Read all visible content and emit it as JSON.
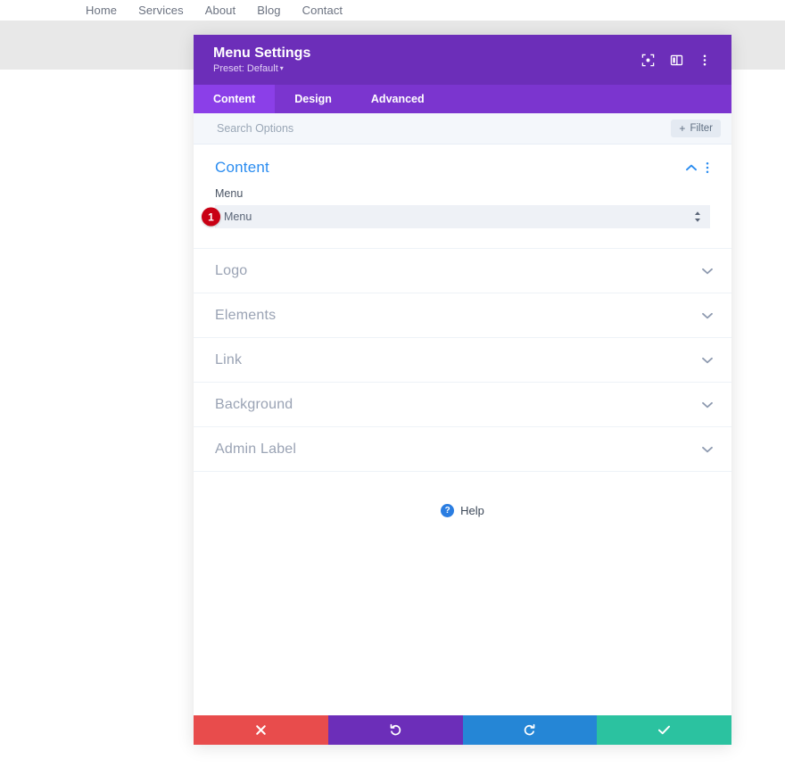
{
  "site": {
    "nav_items": [
      {
        "label": "Home"
      },
      {
        "label": "Services"
      },
      {
        "label": "About"
      },
      {
        "label": "Blog"
      },
      {
        "label": "Contact"
      }
    ]
  },
  "modal": {
    "title": "Menu Settings",
    "preset": "Preset: Default",
    "preset_caret": "▾",
    "header_icons": [
      {
        "name": "fullscreen-icon"
      },
      {
        "name": "layout-columns-icon"
      },
      {
        "name": "more-vertical-icon"
      }
    ],
    "tabs": [
      {
        "label": "Content",
        "active": true
      },
      {
        "label": "Design",
        "active": false
      },
      {
        "label": "Advanced",
        "active": false
      }
    ],
    "search": {
      "placeholder": "Search Options",
      "value": ""
    },
    "filter_button": {
      "plus": "+",
      "label": "Filter"
    },
    "content_section": {
      "title": "Content",
      "field_label": "Menu",
      "select_value": "Menu",
      "step_badge": "1"
    },
    "accordions": [
      {
        "label": "Logo"
      },
      {
        "label": "Elements"
      },
      {
        "label": "Link"
      },
      {
        "label": "Background"
      },
      {
        "label": "Admin Label"
      }
    ],
    "help": {
      "icon_char": "?",
      "label": "Help"
    },
    "footer_buttons": [
      {
        "name": "cancel-button",
        "icon": "close-icon",
        "color": "#e84c4c"
      },
      {
        "name": "undo-button",
        "icon": "undo-icon",
        "color": "#6c2eb9"
      },
      {
        "name": "redo-button",
        "icon": "redo-icon",
        "color": "#2586d6"
      },
      {
        "name": "save-button",
        "icon": "check-icon",
        "color": "#2bc2a0"
      }
    ]
  },
  "colors": {
    "header_purple": "#6c2eb9",
    "tabs_purple": "#7b35cf",
    "tab_active_purple": "#8b3fe8",
    "accent_blue": "#2a8cf0",
    "badge_red": "#c90014"
  }
}
